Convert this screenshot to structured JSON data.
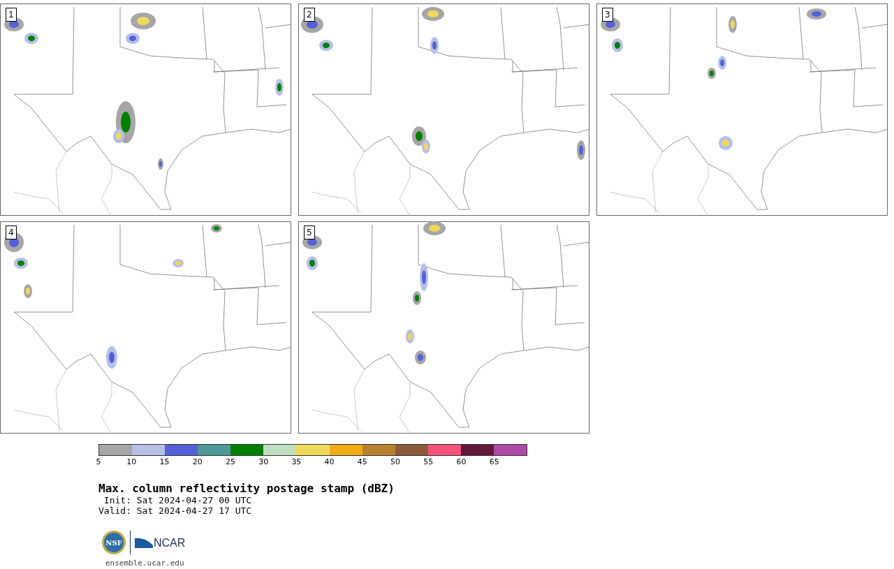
{
  "panels": [
    {
      "label": "1"
    },
    {
      "label": "2"
    },
    {
      "label": "3"
    },
    {
      "label": "4"
    },
    {
      "label": "5"
    }
  ],
  "colorbar": {
    "segments": [
      {
        "color": "#a6a6a6"
      },
      {
        "color": "#b5bfe8"
      },
      {
        "color": "#5461d6"
      },
      {
        "color": "#4f9799"
      },
      {
        "color": "#008000"
      },
      {
        "color": "#bfdfbf"
      },
      {
        "color": "#f0d95a"
      },
      {
        "color": "#f0ab17"
      },
      {
        "color": "#b8812f"
      },
      {
        "color": "#8b5a3c"
      },
      {
        "color": "#f4537a"
      },
      {
        "color": "#621838"
      },
      {
        "color": "#ad4ba8"
      }
    ],
    "ticks": [
      "5",
      "10",
      "15",
      "20",
      "25",
      "30",
      "35",
      "40",
      "45",
      "50",
      "55",
      "60",
      "65"
    ]
  },
  "title": "Max. column reflectivity postage stamp (dBZ)",
  "init": " Init: Sat 2024-04-27 00 UTC",
  "valid": "Valid: Sat 2024-04-27 17 UTC",
  "logo": {
    "seal": "NSF",
    "wordmark": "NCAR"
  },
  "footer": "ensemble.ucar.edu"
}
